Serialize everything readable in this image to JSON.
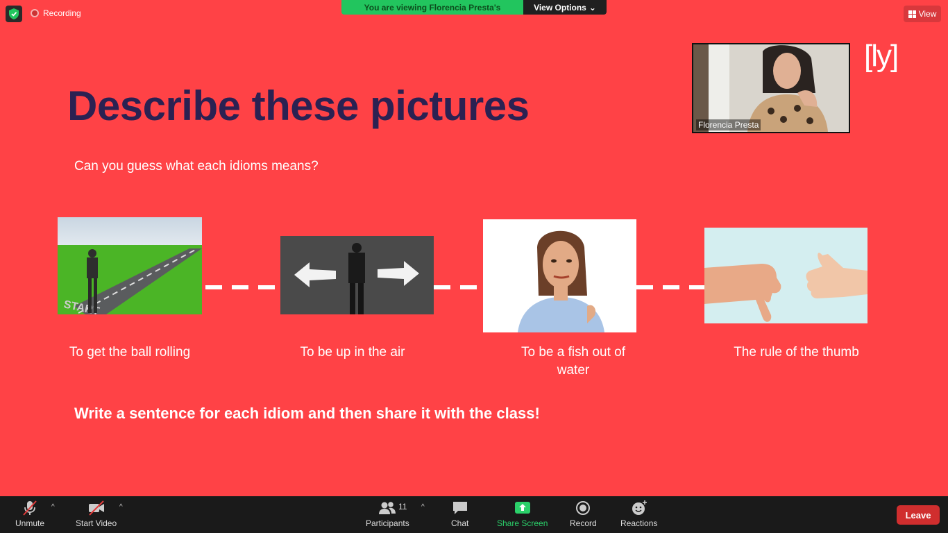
{
  "top": {
    "recording_label": "Recording",
    "viewing_text": "You are viewing Florencia Presta's screen",
    "view_options_label": "View Options",
    "view_label": "View"
  },
  "slide": {
    "title": "Describe these pictures",
    "subtitle": "Can you guess what each idioms means?",
    "logo": "[ly]",
    "captions": [
      "To get the ball rolling",
      "To be up in the air",
      "To be a fish out of water",
      "The rule of the thumb"
    ],
    "call_to_action": "Write a sentence for each idiom and then share it with the class!"
  },
  "video": {
    "participant_name": "Florencia Presta"
  },
  "toolbar": {
    "unmute": "Unmute",
    "start_video": "Start Video",
    "participants": "Participants",
    "participants_count": "11",
    "chat": "Chat",
    "share_screen": "Share Screen",
    "record": "Record",
    "reactions": "Reactions",
    "leave": "Leave"
  },
  "colors": {
    "slide_bg": "#ff4246",
    "title": "#2b2152",
    "share_green": "#2bd06a",
    "leave_red": "#d02e2e"
  }
}
